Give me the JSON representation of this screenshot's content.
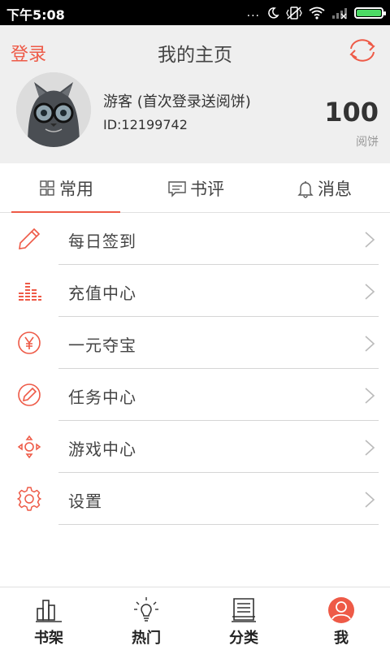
{
  "status_bar": {
    "time": "下午5:08",
    "indicator": "...",
    "icons": [
      "moon-icon",
      "vibrate-icon",
      "wifi-icon",
      "signal-icon",
      "battery-icon"
    ],
    "battery_level": 1.0
  },
  "header": {
    "login_label": "登录",
    "title": "我的主页",
    "sync_icon": "sync-icon",
    "username": "游客 (首次登录送阅饼)",
    "user_id": "ID:12199742",
    "coins_value": "100",
    "coins_label": "阅饼"
  },
  "tabs": [
    {
      "label": "常用",
      "icon": "grid-icon",
      "active": true
    },
    {
      "label": "书评",
      "icon": "comment-icon",
      "active": false
    },
    {
      "label": "消息",
      "icon": "bell-icon",
      "active": false
    }
  ],
  "menu": [
    {
      "label": "每日签到",
      "icon": "pencil-icon"
    },
    {
      "label": "充值中心",
      "icon": "equalizer-icon"
    },
    {
      "label": "一元夺宝",
      "icon": "yen-icon"
    },
    {
      "label": "任务中心",
      "icon": "task-icon"
    },
    {
      "label": "游戏中心",
      "icon": "gamepad-icon"
    },
    {
      "label": "设置",
      "icon": "gear-icon"
    }
  ],
  "bottom_nav": [
    {
      "label": "书架",
      "icon": "bookshelf-icon",
      "active": false
    },
    {
      "label": "热门",
      "icon": "lightbulb-icon",
      "active": false
    },
    {
      "label": "分类",
      "icon": "category-icon",
      "active": false
    },
    {
      "label": "我",
      "icon": "user-icon",
      "active": true
    }
  ],
  "colors": {
    "accent": "#ee5a47",
    "header_bg": "#efefef",
    "status_bar_bg": "#000000",
    "battery_fill": "#4cd964"
  }
}
